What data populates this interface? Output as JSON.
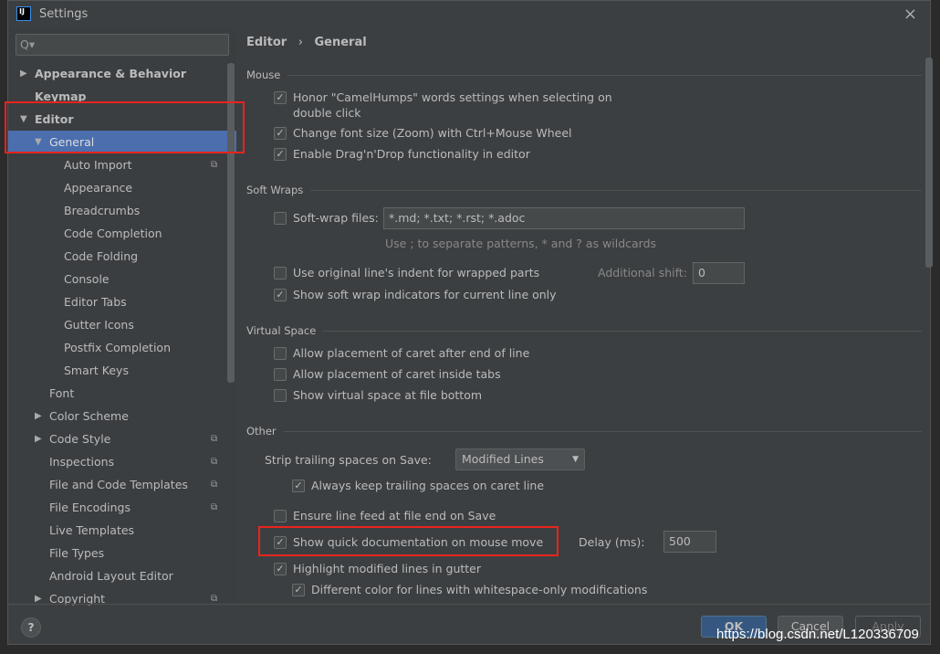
{
  "window": {
    "title": "Settings",
    "logo": "IJ",
    "close": "×"
  },
  "search": {
    "placeholder": "Q▾"
  },
  "tree": [
    {
      "label": "Appearance & Behavior",
      "level": 0,
      "arrow": "▶",
      "bold": true
    },
    {
      "label": "Keymap",
      "level": 0,
      "bold": true
    },
    {
      "label": "Editor",
      "level": 0,
      "arrow": "▼",
      "bold": true
    },
    {
      "label": "General",
      "level": 1,
      "arrow": "▼",
      "selected": true
    },
    {
      "label": "Auto Import",
      "level": 2,
      "copy": true
    },
    {
      "label": "Appearance",
      "level": 2
    },
    {
      "label": "Breadcrumbs",
      "level": 2
    },
    {
      "label": "Code Completion",
      "level": 2
    },
    {
      "label": "Code Folding",
      "level": 2
    },
    {
      "label": "Console",
      "level": 2
    },
    {
      "label": "Editor Tabs",
      "level": 2
    },
    {
      "label": "Gutter Icons",
      "level": 2
    },
    {
      "label": "Postfix Completion",
      "level": 2
    },
    {
      "label": "Smart Keys",
      "level": 2
    },
    {
      "label": "Font",
      "level": 1
    },
    {
      "label": "Color Scheme",
      "level": 1,
      "arrow": "▶"
    },
    {
      "label": "Code Style",
      "level": 1,
      "arrow": "▶",
      "copy": true
    },
    {
      "label": "Inspections",
      "level": 1,
      "copy": true
    },
    {
      "label": "File and Code Templates",
      "level": 1,
      "copy": true
    },
    {
      "label": "File Encodings",
      "level": 1,
      "copy": true
    },
    {
      "label": "Live Templates",
      "level": 1
    },
    {
      "label": "File Types",
      "level": 1
    },
    {
      "label": "Android Layout Editor",
      "level": 1
    },
    {
      "label": "Copyright",
      "level": 1,
      "arrow": "▶",
      "copy": true
    }
  ],
  "breadcrumb": {
    "parent": "Editor",
    "sep": "›",
    "current": "General"
  },
  "sections": {
    "mouse": "Mouse",
    "soft_wraps": "Soft Wraps",
    "virtual_space": "Virtual Space",
    "other": "Other"
  },
  "mouse": {
    "camel": "Honor \"CamelHumps\" words settings when selecting on",
    "camel2": "double click",
    "zoom": "Change font size (Zoom) with Ctrl+Mouse Wheel",
    "dnd": "Enable Drag'n'Drop functionality in editor"
  },
  "soft": {
    "files_label": "Soft-wrap files:",
    "files_value": "*.md; *.txt; *.rst; *.adoc",
    "hint": "Use ; to separate patterns, * and ? as wildcards",
    "indent": "Use original line's indent for wrapped parts",
    "shift_label": "Additional shift:",
    "shift_value": "0",
    "indicators": "Show soft wrap indicators for current line only"
  },
  "virtual": {
    "after_end": "Allow placement of caret after end of line",
    "inside_tabs": "Allow placement of caret inside tabs",
    "file_bottom": "Show virtual space at file bottom"
  },
  "other": {
    "strip_label": "Strip trailing spaces on Save:",
    "strip_value": "Modified Lines",
    "keep": "Always keep trailing spaces on caret line",
    "line_feed": "Ensure line feed at file end on Save",
    "quick_doc": "Show quick documentation on mouse move",
    "delay_label": "Delay (ms):",
    "delay_value": "500",
    "highlight": "Highlight modified lines in gutter",
    "whitespace": "Different color for lines with whitespace-only modifications"
  },
  "check": "✓",
  "footer": {
    "help": "?",
    "ok": "OK",
    "cancel": "Cancel",
    "apply": "Apply"
  },
  "watermark": "https://blog.csdn.net/L120336709"
}
